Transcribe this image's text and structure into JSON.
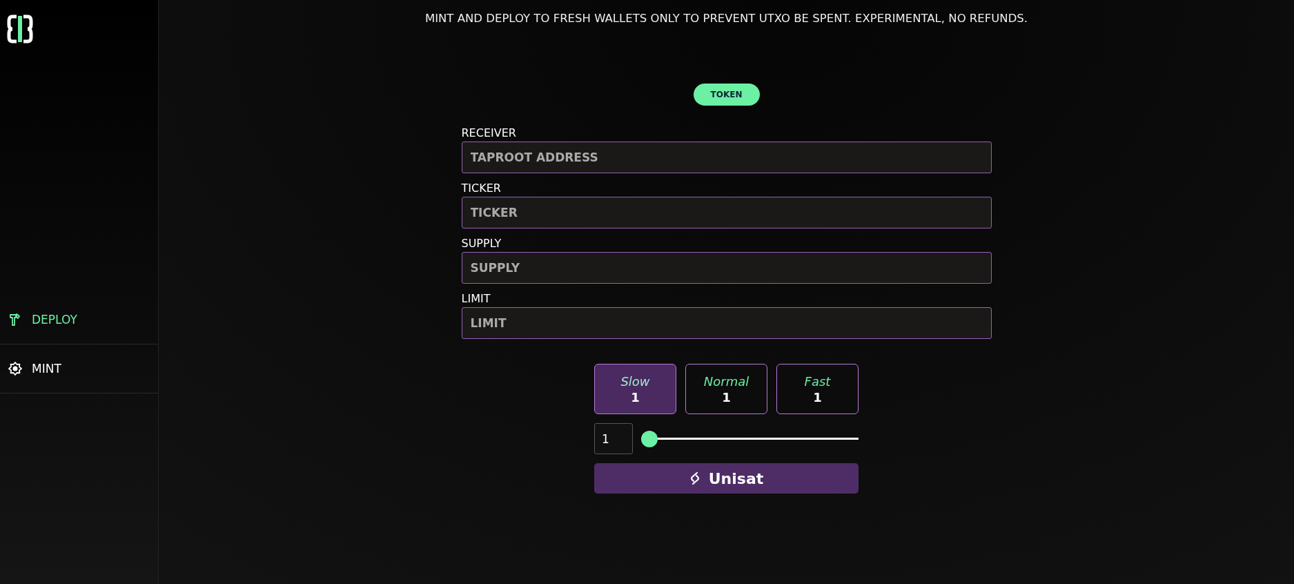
{
  "sidebar": {
    "items": [
      {
        "label": "DEPLOY",
        "kind": "hammer",
        "selected": true
      },
      {
        "label": "MINT",
        "kind": "gear",
        "selected": false
      }
    ]
  },
  "notice": "MINT AND DEPLOY TO FRESH WALLETS ONLY TO PREVENT UTXO BE SPENT. EXPERIMENTAL, NO REFUNDS.",
  "mode_tab": {
    "label": "TOKEN",
    "selected": true
  },
  "fields": [
    {
      "label": "RECEIVER",
      "placeholder": "TAPROOT ADDRESS"
    },
    {
      "label": "TICKER",
      "placeholder": "TICKER"
    },
    {
      "label": "SUPPLY",
      "placeholder": "SUPPLY"
    },
    {
      "label": "LIMIT",
      "placeholder": "LIMIT"
    }
  ],
  "fee_options": [
    {
      "label": "Slow",
      "value": "1",
      "selected": true
    },
    {
      "label": "Normal",
      "value": "1",
      "selected": false
    },
    {
      "label": "Fast",
      "value": "1",
      "selected": false
    }
  ],
  "fee_rate": {
    "value": "1",
    "level": 0
  },
  "wallet_button": {
    "label": "Unisat"
  }
}
